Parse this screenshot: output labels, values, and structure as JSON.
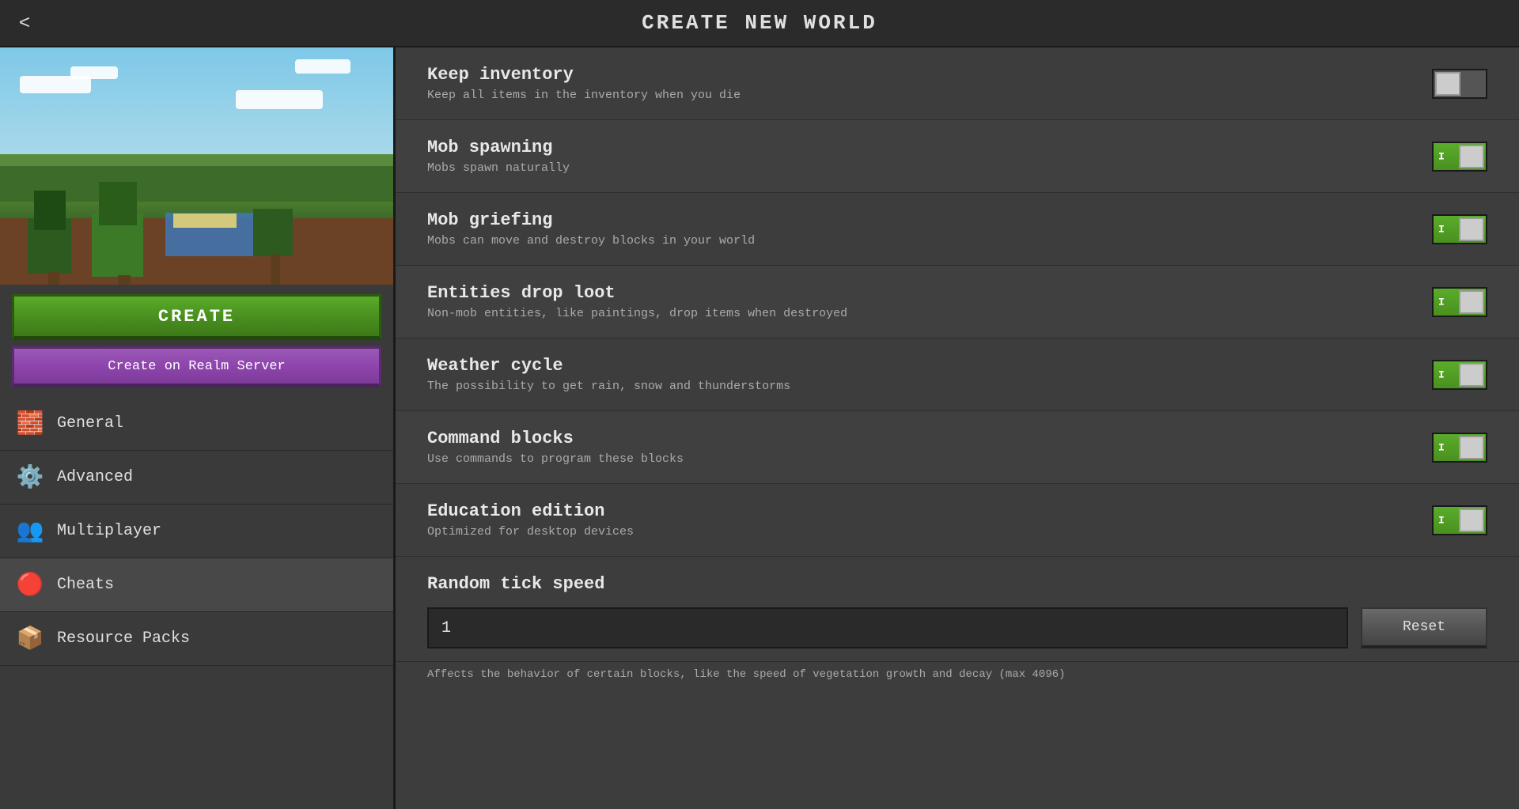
{
  "header": {
    "title": "CREATE NEW WORLD",
    "back_label": "<"
  },
  "sidebar": {
    "create_button": "CREATE",
    "realm_button": "Create on Realm Server",
    "nav_items": [
      {
        "id": "general",
        "label": "General",
        "icon": "🧱",
        "active": false
      },
      {
        "id": "advanced",
        "label": "Advanced",
        "icon": "⚙️",
        "active": false
      },
      {
        "id": "multiplayer",
        "label": "Multiplayer",
        "icon": "👥",
        "active": false
      },
      {
        "id": "cheats",
        "label": "Cheats",
        "icon": "🔴",
        "active": true
      },
      {
        "id": "resource-packs",
        "label": "Resource Packs",
        "icon": "📦",
        "active": false
      }
    ]
  },
  "content": {
    "settings": [
      {
        "id": "keep-inventory",
        "name": "Keep inventory",
        "desc": "Keep all items in the inventory when you die",
        "type": "toggle",
        "value": false
      },
      {
        "id": "mob-spawning",
        "name": "Mob spawning",
        "desc": "Mobs spawn naturally",
        "type": "toggle",
        "value": true
      },
      {
        "id": "mob-griefing",
        "name": "Mob griefing",
        "desc": "Mobs can move and destroy blocks in your world",
        "type": "toggle",
        "value": true
      },
      {
        "id": "entities-drop-loot",
        "name": "Entities drop loot",
        "desc": "Non-mob entities, like paintings, drop items when destroyed",
        "type": "toggle",
        "value": true
      },
      {
        "id": "weather-cycle",
        "name": "Weather cycle",
        "desc": "The possibility to get rain, snow and thunderstorms",
        "type": "toggle",
        "value": true
      },
      {
        "id": "command-blocks",
        "name": "Command blocks",
        "desc": "Use commands to program these blocks",
        "type": "toggle",
        "value": true
      },
      {
        "id": "education-edition",
        "name": "Education edition",
        "desc": "Optimized for desktop devices",
        "type": "toggle",
        "value": true
      }
    ],
    "tick_speed": {
      "label": "Random tick speed",
      "value": "1",
      "reset_label": "Reset",
      "note": "Affects the behavior of certain blocks, like the speed of vegetation growth and decay (max 4096)"
    }
  }
}
